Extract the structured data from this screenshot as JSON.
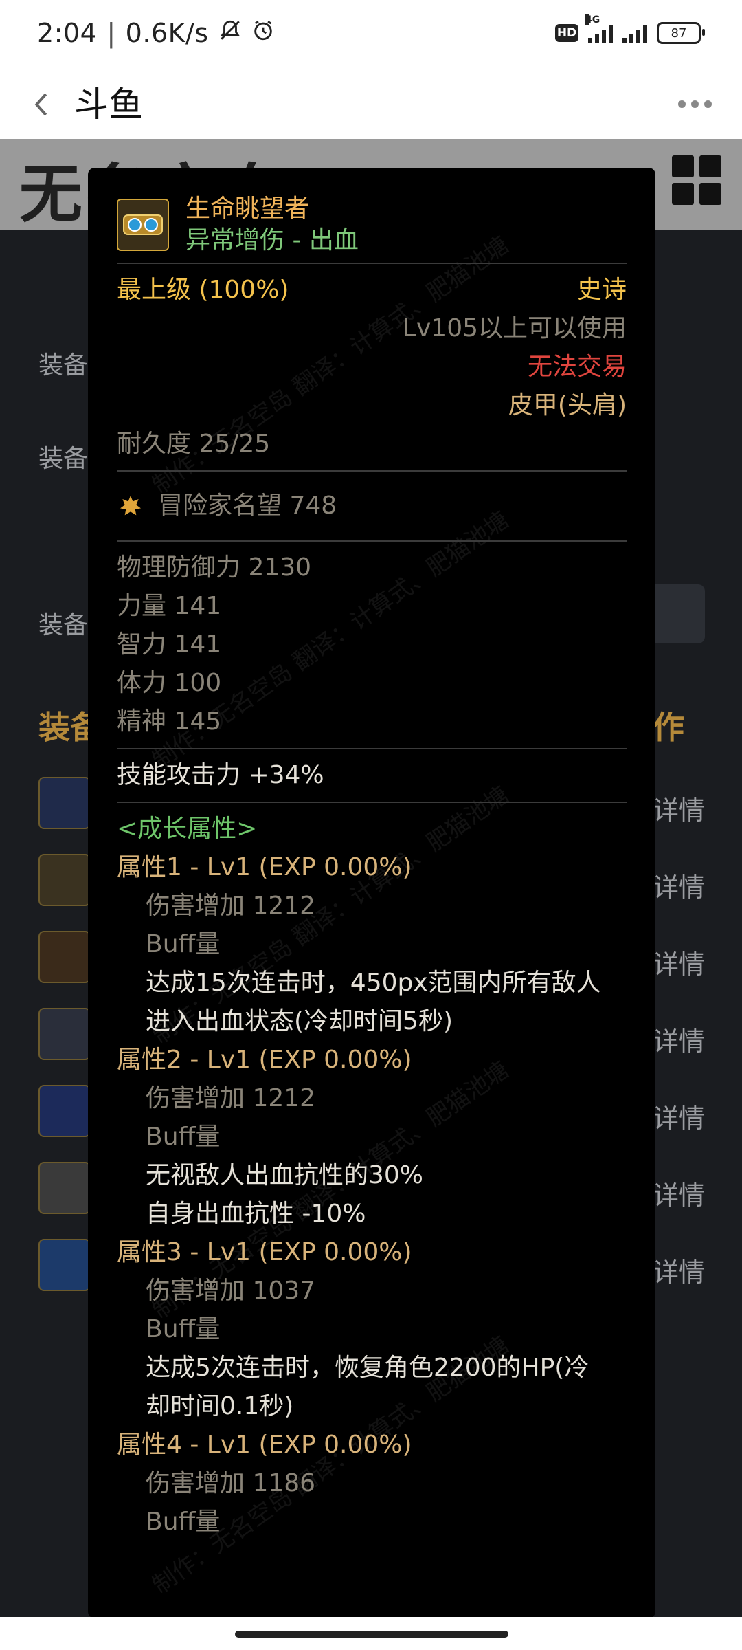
{
  "status": {
    "time": "2:04",
    "speed": "0.6K/s",
    "hd": "HD",
    "network": "4G",
    "battery": "87"
  },
  "header": {
    "title": "斗鱼"
  },
  "background": {
    "row_labels": [
      "装备",
      "装备",
      "装备"
    ],
    "section_left": "装备",
    "section_right": "作",
    "detail_label": "详情",
    "accent_color": "#b58a3a"
  },
  "tooltip": {
    "item_name": "生命眺望者",
    "item_subtitle": "异常增伤 - 出血",
    "grade": "最上级 (100%)",
    "rarity": "史诗",
    "level_req": "Lv105以上可以使用",
    "trade": "无法交易",
    "type": "皮甲(头肩)",
    "durability": "耐久度 25/25",
    "renown": "冒险家名望 748",
    "stats": [
      "物理防御力  2130",
      "力量  141",
      "智力  141",
      "体力  100",
      "精神  145"
    ],
    "skill_attack": "技能攻击力  +34%",
    "growth_header": "<成长属性>",
    "attrs": [
      {
        "title": "属性1 - Lv1 (EXP 0.00%)",
        "damage": "伤害增加   1212",
        "buff": "Buff量",
        "effect": [
          "达成15次连击时，450px范围内所有敌人",
          "进入出血状态(冷却时间5秒)"
        ]
      },
      {
        "title": "属性2 - Lv1 (EXP 0.00%)",
        "damage": "伤害增加   1212",
        "buff": "Buff量",
        "effect": [
          "无视敌人出血抗性的30%",
          "自身出血抗性 -10%"
        ]
      },
      {
        "title": "属性3 - Lv1 (EXP 0.00%)",
        "damage": "伤害增加   1037",
        "buff": "Buff量",
        "effect": [
          "达成5次连击时，恢复角色2200的HP(冷",
          "却时间0.1秒)"
        ]
      },
      {
        "title": "属性4 - Lv1 (EXP 0.00%)",
        "damage": "伤害增加   1186",
        "buff": "Buff量"
      }
    ],
    "watermark": "制作：无名空岛  翻译：计算式、肥猫池塘"
  }
}
